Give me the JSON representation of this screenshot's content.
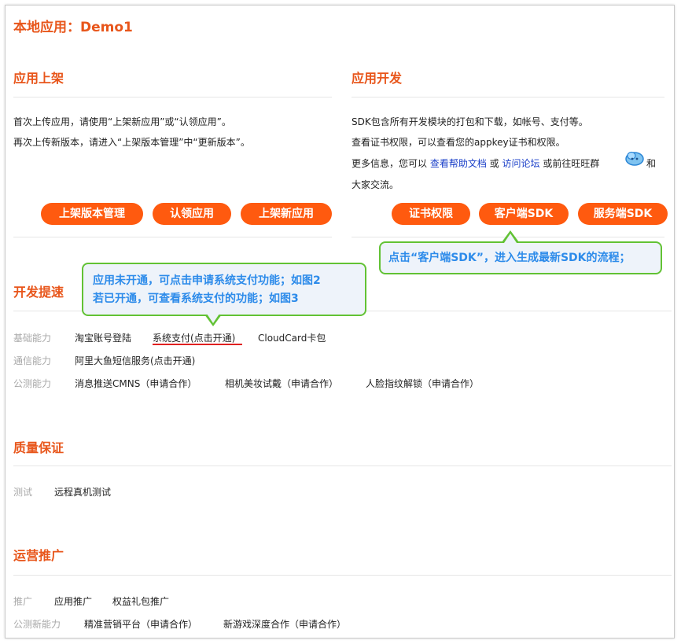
{
  "page_title": "本地应用：Demo1",
  "publish": {
    "title": "应用上架",
    "lines": [
      "首次上传应用，请使用“上架新应用”或“认领应用”。",
      "再次上传新版本，请进入“上架版本管理”中“更新版本”。"
    ],
    "buttons": [
      "上架版本管理",
      "认领应用",
      "上架新应用"
    ]
  },
  "develop": {
    "title": "应用开发",
    "line1": "SDK包含所有开发模块的打包和下载，如帐号、支付等。",
    "line2": "查看证书权限，可以查看您的appkey证书和权限。",
    "more_prefix": "更多信息，您可以 ",
    "help_link": "查看帮助文档",
    "or": " 或 ",
    "forum_link": "访问论坛",
    "more_suffix": " 或前往旺旺群",
    "and": " 和",
    "line4": "大家交流。",
    "buttons": [
      "证书权限",
      "客户端SDK",
      "服务端SDK"
    ]
  },
  "callout_sdk": "点击“客户端SDK”，进入生成最新SDK的流程；",
  "callout_pay": [
    "应用未开通，可点击申请系统支付功能；如图2",
    "若已开通，可查看系统支付的功能；如图3"
  ],
  "accel": {
    "title": "开发提速",
    "rows": [
      {
        "label": "基础能力",
        "items": [
          "淘宝账号登陆",
          "系统支付(点击开通)",
          "CloudCard卡包"
        ]
      },
      {
        "label": "通信能力",
        "items": [
          "阿里大鱼短信服务(点击开通)"
        ]
      },
      {
        "label": "公测能力",
        "items": [
          "消息推送CMNS（申请合作）",
          "相机美妆试戴（申请合作）",
          "人脸指纹解锁（申请合作）"
        ]
      }
    ]
  },
  "quality": {
    "title": "质量保证",
    "rows": [
      {
        "label": "测试",
        "items": [
          "远程真机测试"
        ]
      }
    ]
  },
  "ops": {
    "title": "运营推广",
    "rows": [
      {
        "label": "推广",
        "items": [
          "应用推广",
          "权益礼包推广"
        ]
      },
      {
        "label": "公测新能力",
        "items": [
          "精准营销平台（申请合作）",
          "新游戏深度合作（申请合作）"
        ]
      }
    ]
  },
  "colors": {
    "accent": "#e8561b",
    "button": "#ff5a0f",
    "callout_border": "#62c234",
    "callout_text": "#2d8bea",
    "link": "#1a3fc8",
    "underline": "#e02020"
  },
  "icons": {
    "wangwang": "cloud-chat-icon"
  }
}
